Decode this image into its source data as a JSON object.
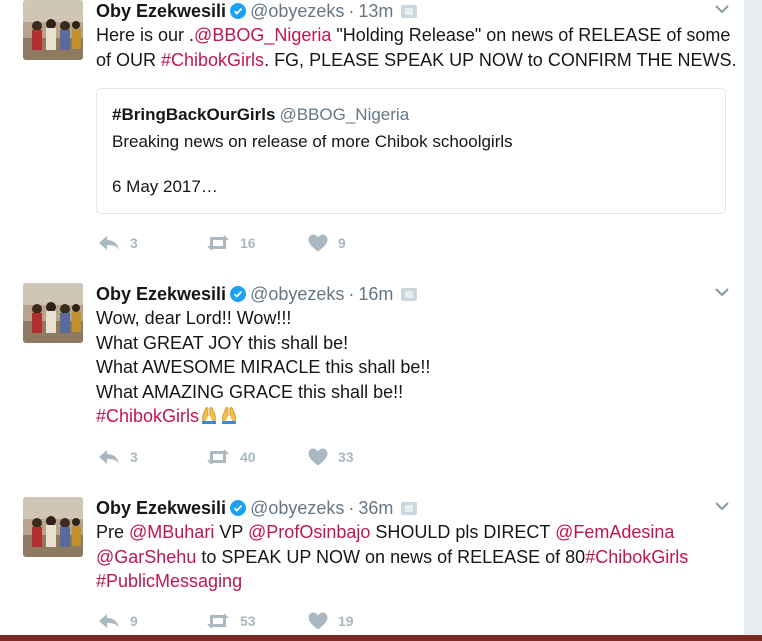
{
  "colors": {
    "link": "#c0174b",
    "muted": "#657786",
    "action": "#aab8c2",
    "verified": "#1da1f2"
  },
  "tweets": [
    {
      "name": "Oby Ezekwesili",
      "handle": "@obyezeks",
      "sep": "·",
      "time": "13m",
      "lines": [
        [
          {
            "t": "Here is our ."
          },
          {
            "t": "@BBOG_Nigeria",
            "link": true
          },
          {
            "t": " \"Holding Release\" on news of RELEASE of some"
          }
        ],
        [
          {
            "t": "of OUR "
          },
          {
            "t": "#ChibokGirls",
            "link": true
          },
          {
            "t": ". FG, PLEASE SPEAK UP NOW to CONFIRM THE NEWS."
          }
        ]
      ],
      "quote": {
        "name": "#BringBackOurGirls",
        "handle": "@BBOG_Nigeria",
        "text": "Breaking news on release of more Chibok schoolgirls",
        "date": "6 May 2017…"
      },
      "reply_icon": "reply-icon",
      "retweet_icon": "retweet-icon",
      "like_icon": "heart-icon",
      "replies": "3",
      "retweets": "16",
      "likes": "9"
    },
    {
      "name": "Oby Ezekwesili",
      "handle": "@obyezeks",
      "sep": "·",
      "time": "16m",
      "lines": [
        [
          {
            "t": "Wow, dear Lord!! Wow!!!"
          }
        ],
        [
          {
            "t": "What GREAT JOY this shall be!"
          }
        ],
        [
          {
            "t": "What AWESOME MIRACLE this shall be!!"
          }
        ],
        [
          {
            "t": "What AMAZING GRACE this shall be!!"
          }
        ],
        [
          {
            "t": "#ChibokGirls",
            "link": true
          },
          {
            "emoji": "praying-hands-emoji"
          },
          {
            "emoji": "praying-hands-emoji"
          }
        ]
      ],
      "replies": "3",
      "retweets": "40",
      "likes": "33"
    },
    {
      "name": "Oby Ezekwesili",
      "handle": "@obyezeks",
      "sep": "·",
      "time": "36m",
      "lines": [
        [
          {
            "t": "Pre "
          },
          {
            "t": "@MBuhari",
            "link": true
          },
          {
            "t": "  VP "
          },
          {
            "t": "@ProfOsinbajo",
            "link": true
          },
          {
            "t": " SHOULD pls DIRECT "
          },
          {
            "t": "@FemAdesina",
            "link": true
          }
        ],
        [
          {
            "t": "@GarShehu",
            "link": true
          },
          {
            "t": " to SPEAK UP NOW on news of RELEASE of 80"
          },
          {
            "t": "#ChibokGirls",
            "link": true
          }
        ],
        [
          {
            "t": "#PublicMessaging",
            "link": true
          }
        ]
      ],
      "replies": "9",
      "retweets": "53",
      "likes": "19"
    }
  ]
}
